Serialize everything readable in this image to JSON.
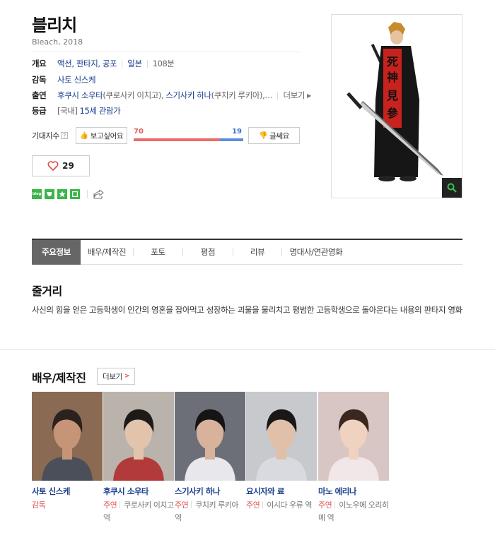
{
  "movie": {
    "title": "블리치",
    "subtitle": "Bleach, 2018"
  },
  "info": {
    "overview_label": "개요",
    "genres": "액션, 판타지, 공포",
    "country": "일본",
    "runtime": "108분",
    "director_label": "감독",
    "director": "사토 신스케",
    "cast_label": "출연",
    "cast_1_actor": "후쿠시 소우타",
    "cast_1_role": "(쿠로사키 이치고),",
    "cast_2_actor": "스기사키 하나",
    "cast_2_role": "(쿠치키 루키아),…",
    "more_label": "더보기",
    "rating_label": "등급",
    "rating_region": "[국내]",
    "rating": "15세 관람가"
  },
  "expectation": {
    "label": "기대지수",
    "want_button": "보고싶어요",
    "want_count": "70",
    "dislike_count": "19",
    "dislike_button": "글쎄요",
    "want_ratio": 0.787
  },
  "like": {
    "count": "29"
  },
  "share": {
    "blog_label": "blog"
  },
  "tabs": [
    "주요정보",
    "배우/제작진",
    "포토",
    "평점",
    "리뷰",
    "명대사/연관영화"
  ],
  "synopsis": {
    "heading": "줄거리",
    "text": "사신의 힘을 얻은 고등학생이 인간의 영혼을 잡아먹고 성장하는 괴물을 물리치고 평범한 고등학생으로 돌아온다는 내용의 판타지 영화"
  },
  "cast_section": {
    "heading": "배우/제작진",
    "more_label": "더보기",
    "people": [
      {
        "name": "사토 신스케",
        "kind": "감독",
        "role": ""
      },
      {
        "name": "후쿠시 소우타",
        "kind": "주연",
        "role": "쿠로사키 이치고 역"
      },
      {
        "name": "스기사키 하나",
        "kind": "주연",
        "role": "쿠치키 루키아 역"
      },
      {
        "name": "요시자와 료",
        "kind": "주연",
        "role": "이시다 우류 역"
      },
      {
        "name": "마노 에리나",
        "kind": "주연",
        "role": "이노우에 오리히메 역"
      }
    ]
  },
  "poster": {
    "text": "死神見參"
  },
  "colors": {
    "accent_red": "#e24b4b",
    "accent_blue": "#3b6fd6",
    "link": "#1a3f8f",
    "tab_active": "#666666"
  }
}
